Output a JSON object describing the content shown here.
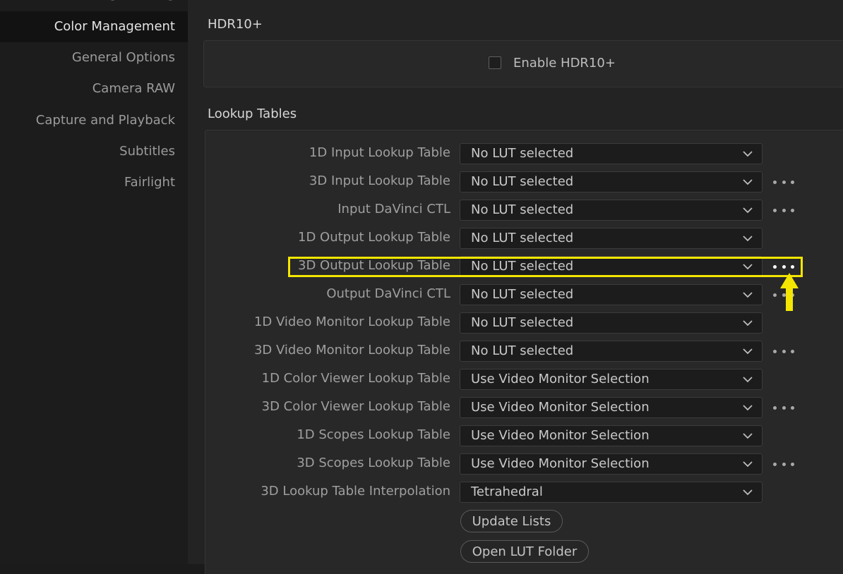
{
  "sidebar": {
    "cut_item": "Image Scaling",
    "items": [
      {
        "label": "Color Management",
        "active": true
      },
      {
        "label": "General Options",
        "active": false
      },
      {
        "label": "Camera RAW",
        "active": false
      },
      {
        "label": "Capture and Playback",
        "active": false
      },
      {
        "label": "Subtitles",
        "active": false
      },
      {
        "label": "Fairlight",
        "active": false
      }
    ]
  },
  "hdr": {
    "title": "HDR10+",
    "checkbox_label": "Enable HDR10+",
    "checked": false
  },
  "lookup": {
    "title": "Lookup Tables",
    "rows": [
      {
        "label": "1D Input Lookup Table",
        "value": "No LUT selected",
        "more": false
      },
      {
        "label": "3D Input Lookup Table",
        "value": "No LUT selected",
        "more": true
      },
      {
        "label": "Input DaVinci CTL",
        "value": "No LUT selected",
        "more": true
      },
      {
        "label": "1D Output Lookup Table",
        "value": "No LUT selected",
        "more": false
      },
      {
        "label": "3D Output Lookup Table",
        "value": "No LUT selected",
        "more": true
      },
      {
        "label": "Output DaVinci CTL",
        "value": "No LUT selected",
        "more": true
      },
      {
        "label": "1D Video Monitor Lookup Table",
        "value": "No LUT selected",
        "more": false
      },
      {
        "label": "3D Video Monitor Lookup Table",
        "value": "No LUT selected",
        "more": true
      },
      {
        "label": "1D Color Viewer Lookup Table",
        "value": "Use Video Monitor Selection",
        "more": false
      },
      {
        "label": "3D Color Viewer Lookup Table",
        "value": "Use Video Monitor Selection",
        "more": true
      },
      {
        "label": "1D Scopes Lookup Table",
        "value": "Use Video Monitor Selection",
        "more": false
      },
      {
        "label": "3D Scopes Lookup Table",
        "value": "Use Video Monitor Selection",
        "more": true
      },
      {
        "label": "3D Lookup Table Interpolation",
        "value": "Tetrahedral",
        "more": false
      }
    ],
    "update_button": "Update Lists",
    "open_folder_button": "Open LUT Folder"
  },
  "annotation": {
    "highlight_color": "#f4e600",
    "highlighted_row": "3D Output Lookup Table",
    "arrow_icon": "up-arrow-icon"
  }
}
